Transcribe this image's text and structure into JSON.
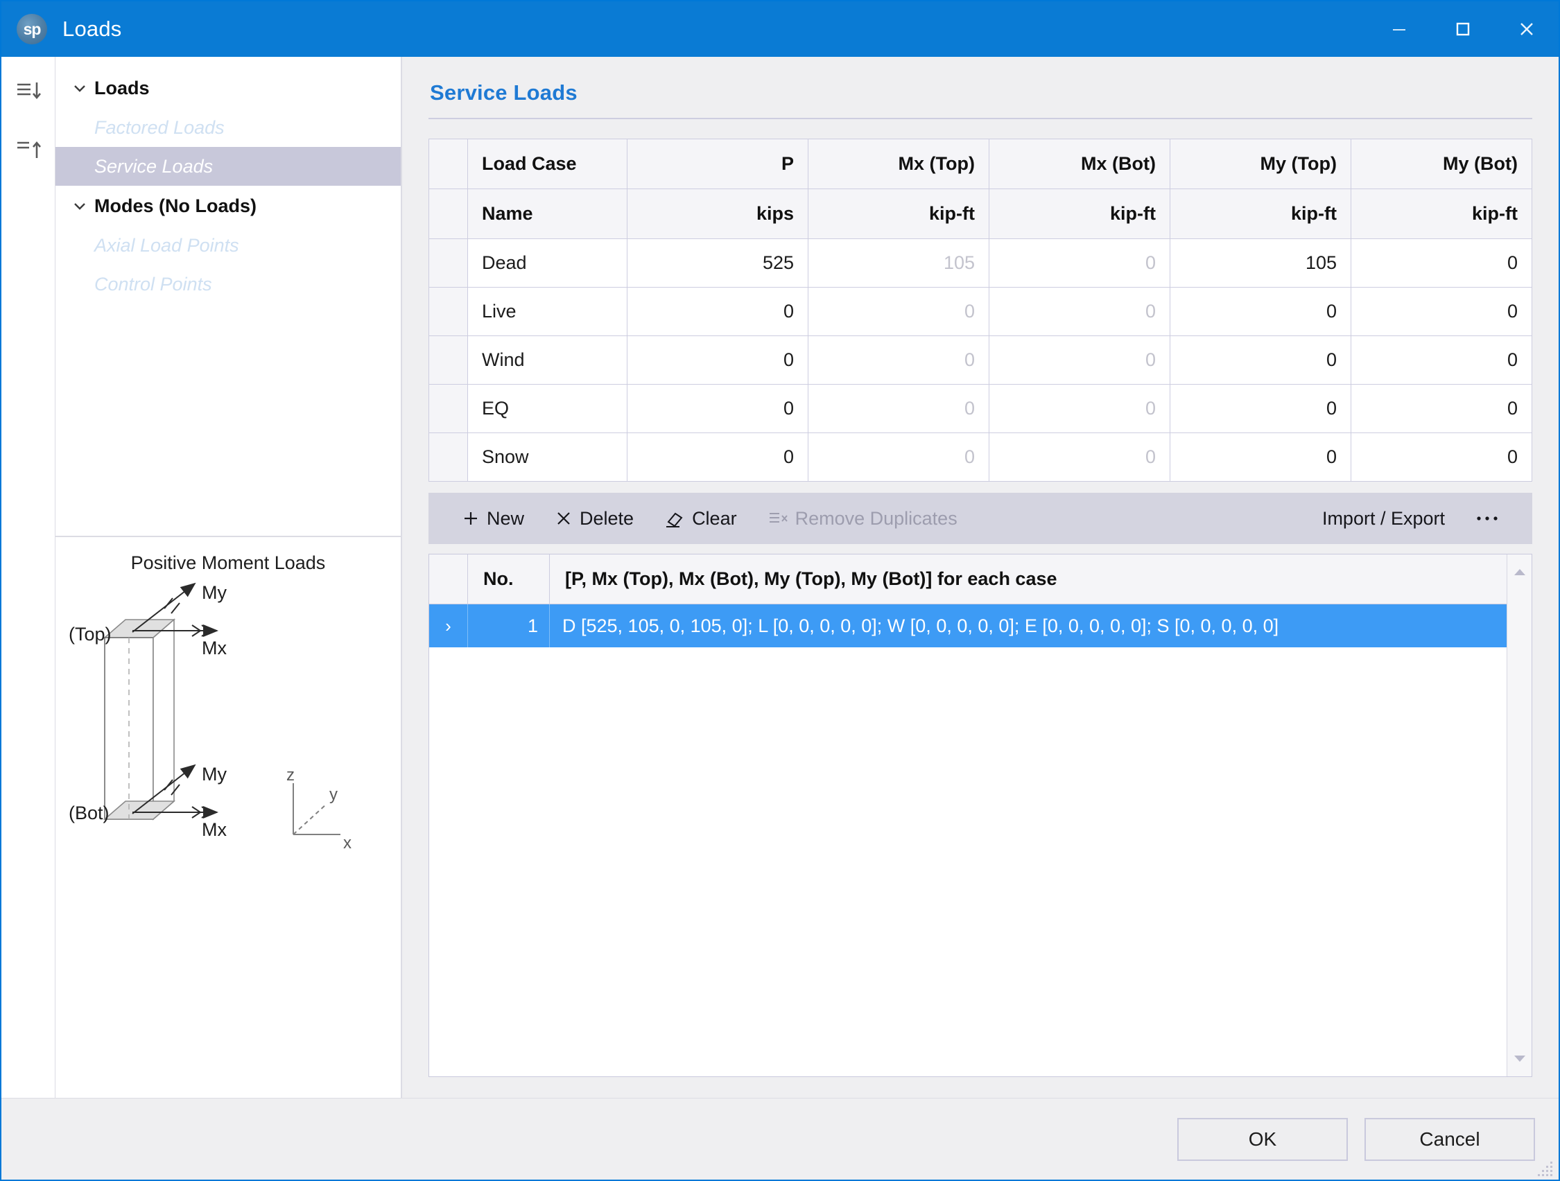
{
  "window": {
    "title": "Loads",
    "logo_text": "sp",
    "controls": {
      "minimize": "minimize-icon",
      "maximize": "maximize-icon",
      "close": "close-icon"
    }
  },
  "rail": {
    "expand_all": "expand-all-icon",
    "collapse_all": "collapse-all-icon"
  },
  "tree": {
    "nodes": [
      {
        "label": "Loads",
        "type": "root",
        "expanded": true
      },
      {
        "label": "Factored Loads",
        "type": "child",
        "selected": false
      },
      {
        "label": "Service Loads",
        "type": "child",
        "selected": true
      },
      {
        "label": "Modes (No Loads)",
        "type": "root",
        "expanded": true
      },
      {
        "label": "Axial Load Points",
        "type": "child",
        "selected": false
      },
      {
        "label": "Control Points",
        "type": "child",
        "selected": false
      }
    ]
  },
  "diagram": {
    "title": "Positive Moment Loads",
    "top_label": "(Top)",
    "bot_label": "(Bot)",
    "moment_top_my": "My",
    "moment_top_mx": "Mx",
    "moment_bot_my": "My",
    "moment_bot_mx": "Mx",
    "axis_z": "z",
    "axis_y": "y",
    "axis_x": "x"
  },
  "main": {
    "heading": "Service Loads",
    "table": {
      "columns": [
        "Load Case",
        "P",
        "Mx (Top)",
        "Mx (Bot)",
        "My (Top)",
        "My (Bot)"
      ],
      "units": [
        "Name",
        "kips",
        "kip-ft",
        "kip-ft",
        "kip-ft",
        "kip-ft"
      ],
      "disabled_columns": [
        2,
        3
      ],
      "rows": [
        {
          "name": "Dead",
          "p": "525",
          "mx_top": "105",
          "mx_bot": "0",
          "my_top": "105",
          "my_bot": "0"
        },
        {
          "name": "Live",
          "p": "0",
          "mx_top": "0",
          "mx_bot": "0",
          "my_top": "0",
          "my_bot": "0"
        },
        {
          "name": "Wind",
          "p": "0",
          "mx_top": "0",
          "mx_bot": "0",
          "my_top": "0",
          "my_bot": "0"
        },
        {
          "name": "EQ",
          "p": "0",
          "mx_top": "0",
          "mx_bot": "0",
          "my_top": "0",
          "my_bot": "0"
        },
        {
          "name": "Snow",
          "p": "0",
          "mx_top": "0",
          "mx_bot": "0",
          "my_top": "0",
          "my_bot": "0"
        }
      ]
    },
    "toolbar": {
      "new": "New",
      "delete": "Delete",
      "clear": "Clear",
      "remove_duplicates": "Remove Duplicates",
      "remove_duplicates_disabled": true,
      "import_export": "Import / Export",
      "overflow": "• • •"
    },
    "grid": {
      "col_no": "No.",
      "col_desc": "[P, Mx (Top), Mx (Bot), My (Top), My (Bot)] for each case",
      "rows": [
        {
          "indicator": "›",
          "no": "1",
          "desc": "D [525, 105, 0, 105, 0]; L [0, 0, 0, 0, 0]; W [0, 0, 0, 0, 0]; E [0, 0, 0, 0, 0]; S [0, 0, 0, 0, 0]",
          "selected": true
        }
      ]
    }
  },
  "footer": {
    "ok": "OK",
    "cancel": "Cancel"
  },
  "colors": {
    "titlebar": "#0A7BD4",
    "accent_heading": "#1F7AD4",
    "selection_row": "#3D9BF5",
    "tree_selection": "#C8C8DA",
    "toolbar_bg": "#D4D4E0"
  }
}
